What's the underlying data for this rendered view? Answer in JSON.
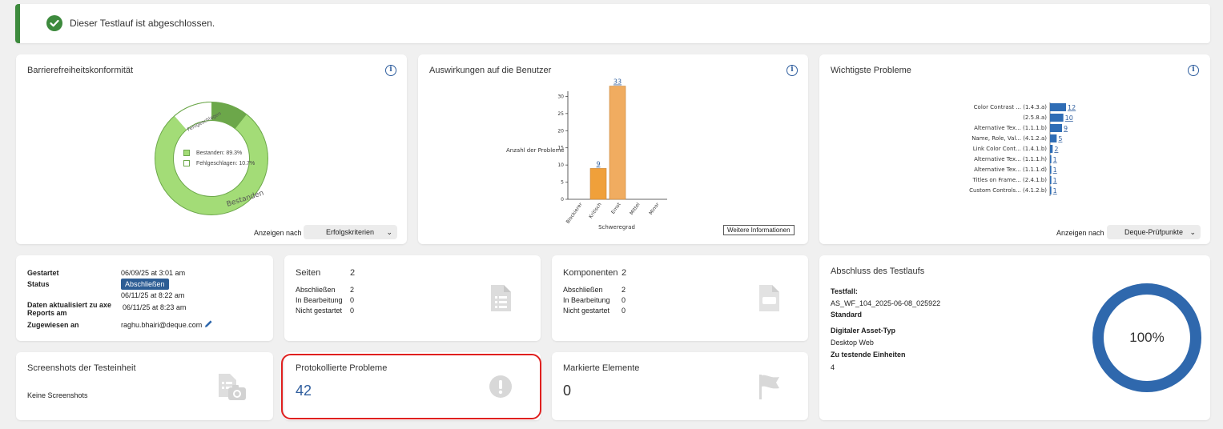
{
  "banner": {
    "message": "Dieser Testlauf ist abgeschlossen."
  },
  "conformance": {
    "title": "Barrierefreiheitskonformität",
    "legend_passed": "Bestanden: 89.3%",
    "legend_failed": "Fehlgeschlagen: 10.7%",
    "ring_label_passed": "Bestanden",
    "ring_label_failed": "Fehlgeschlagen",
    "show_by_label": "Anzeigen nach",
    "show_by_value": "Erfolgskriterien",
    "passed_fraction": 0.893,
    "colors": {
      "passed": "#a3dc77",
      "failed": "#ffffff",
      "stroke": "#6ca74a"
    }
  },
  "impact": {
    "title": "Auswirkungen auf die Benutzer",
    "more_info": "Weitere Informationen",
    "chart_data": {
      "type": "bar",
      "categories": [
        "Blockierer",
        "Kritisch",
        "Ernst",
        "Mittel",
        "Minor"
      ],
      "values": [
        0,
        9,
        33,
        0,
        0
      ],
      "data_labels": [
        "",
        "9",
        "33",
        "",
        ""
      ],
      "xlabel": "Schweregrad",
      "ylabel": "Anzahl der Probleme",
      "ylim": [
        0,
        35
      ],
      "yticks": [
        0,
        5,
        10,
        15,
        20,
        25,
        30
      ],
      "colors": [
        "#f0a03a",
        "#f0a03a",
        "#f0ac60",
        "#f0ac60",
        "#f0ac60"
      ]
    }
  },
  "top_issues": {
    "title": "Wichtigste Probleme",
    "show_by_label": "Anzeigen nach",
    "show_by_value": "Deque-Prüfpunkte",
    "chart_data": {
      "type": "bar",
      "orientation": "horizontal",
      "categories": [
        "Color Contrast ... (1.4.3.a)",
        "(2.5.8.a)",
        "Alternative Tex... (1.1.1.b)",
        "Name, Role, Val... (4.1.2.a)",
        "Link Color Cont... (1.4.1.b)",
        "Alternative Tex... (1.1.1.h)",
        "Alternative Tex... (1.1.1.d)",
        "Titles on Frame... (2.4.1.b)",
        "Custom Controls... (4.1.2.b)"
      ],
      "values": [
        12,
        10,
        9,
        5,
        2,
        1,
        1,
        1,
        1
      ],
      "color": "#2f6db5"
    }
  },
  "details": {
    "started_label": "Gestartet",
    "started_value": "06/09/25 at 3:01 am",
    "status_label": "Status",
    "status_badge": "Abschließen",
    "status_date": "06/11/25 at 8:22 am",
    "updated_label_line1": "Daten aktualisiert zu axe",
    "updated_label_line2": "Reports am",
    "updated_value": "06/11/25 at 8:23 am",
    "assigned_label": "Zugewiesen an",
    "assigned_value": "raghu.bhairi@deque.com"
  },
  "pages": {
    "title": "Seiten",
    "count": "2",
    "rows": [
      {
        "label": "Abschließen",
        "value": "2"
      },
      {
        "label": "In Bearbeitung",
        "value": "0"
      },
      {
        "label": "Nicht gestartet",
        "value": "0"
      }
    ]
  },
  "components": {
    "title": "Komponenten",
    "count": "2",
    "rows": [
      {
        "label": "Abschließen",
        "value": "2"
      },
      {
        "label": "In Bearbeitung",
        "value": "0"
      },
      {
        "label": "Nicht gestartet",
        "value": "0"
      }
    ]
  },
  "completion": {
    "title": "Abschluss des Testlaufs",
    "testcase_label": "Testfall:",
    "testcase_value": "AS_WF_104_2025-06-08_025922",
    "testcase_standard": "Standard",
    "asset_type_label": "Digitaler Asset-Typ",
    "asset_type_value": "Desktop Web",
    "units_label": "Zu testende Einheiten",
    "units_value": "4",
    "percent_text": "100%",
    "percent": 1.0,
    "ring_color": "#2f68ad"
  },
  "screenshots": {
    "title": "Screenshots der Testeinheit",
    "empty": "Keine Screenshots"
  },
  "logged_issues": {
    "title": "Protokollierte Probleme",
    "count": "42"
  },
  "flagged": {
    "title": "Markierte Elemente",
    "count": "0"
  }
}
